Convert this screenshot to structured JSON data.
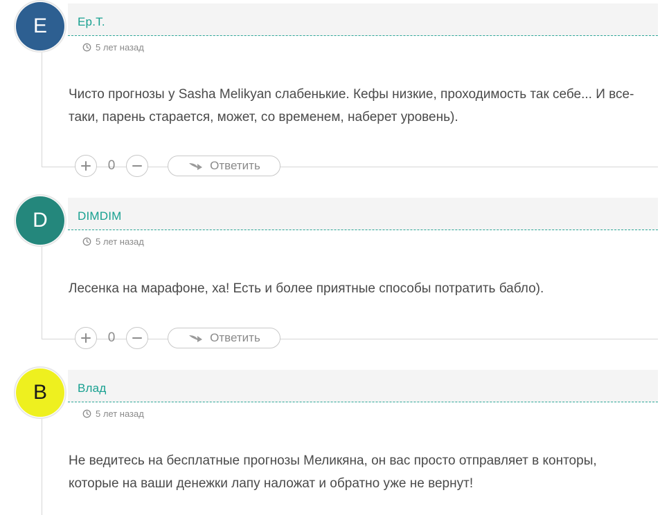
{
  "comments": [
    {
      "author": "Ер.Т.",
      "avatar_letter": "E",
      "avatar_color": "#2d5f91",
      "time": "5 лет назад",
      "text": "Чисто прогнозы у Sasha Melikyan слабенькие. Кефы низкие, проходимость так себе... И все-таки, парень старается, может, со временем, наберет уровень).",
      "votes": "0",
      "reply_label": "Ответить"
    },
    {
      "author": "DIMDIM",
      "avatar_letter": "D",
      "avatar_color": "#24877c",
      "time": "5 лет назад",
      "text": "Лесенка на марафоне, ха! Есть и более приятные способы потратить бабло).",
      "votes": "0",
      "reply_label": "Ответить"
    },
    {
      "author": "Влад",
      "avatar_letter": "B",
      "avatar_color": "#eef01f",
      "time": "5 лет назад",
      "text": "Не ведитесь на бесплатные прогнозы Меликяна, он вас просто отправляет в конторы, которые на ваши денежки лапу наложат и обратно уже не вернут!"
    }
  ],
  "icons": {
    "clock": "clock-icon",
    "upvote": "plus-icon",
    "downvote": "minus-icon",
    "reply": "reply-arrow-icon"
  },
  "colors": {
    "accent": "#17a090",
    "muted": "#8a8a8a",
    "text": "#4a4a4a"
  }
}
